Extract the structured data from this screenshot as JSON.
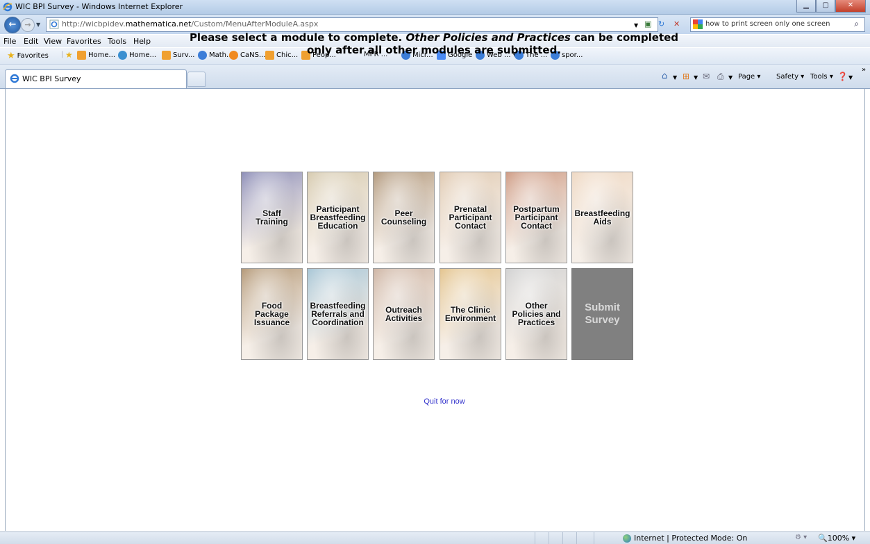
{
  "window": {
    "title": "WIC BPI Survey - Windows Internet Explorer"
  },
  "address": {
    "url_prefix": "http://wicbpidev.",
    "url_domain": "mathematica.net",
    "url_path": "/Custom/MenuAfterModuleA.aspx",
    "search_query": "how to print screen only one screen"
  },
  "menu": [
    "File",
    "Edit",
    "View",
    "Favorites",
    "Tools",
    "Help"
  ],
  "favorites": {
    "label": "Favorites",
    "items": [
      {
        "label": "Home...",
        "icon": "rss-feed-icon",
        "color": "#f0a030"
      },
      {
        "label": "Home...",
        "icon": "web-slice-icon",
        "color": "#3a8fd0"
      },
      {
        "label": "Surv...",
        "icon": "rss-feed-icon",
        "color": "#f0a030"
      },
      {
        "label": "Math...",
        "icon": "ie-page-icon",
        "color": "#3b7dd8"
      },
      {
        "label": "CaNS...",
        "icon": "orange-circle-icon",
        "color": "#f08a20"
      },
      {
        "label": "Chic...",
        "icon": "rss-feed-icon",
        "color": "#f0a030"
      },
      {
        "label": "Peop...",
        "icon": "rss-feed-icon",
        "color": "#f0a030"
      },
      {
        "label": "MPR ...",
        "icon": "",
        "color": ""
      },
      {
        "label": "Micr...",
        "icon": "ie-page-icon",
        "color": "#3b7dd8"
      },
      {
        "label": "Google",
        "icon": "google-icon",
        "color": "#4a8af4"
      },
      {
        "label": "Web ... ▾",
        "icon": "ie-page-icon",
        "color": "#3b7dd8"
      },
      {
        "label": "The ...",
        "icon": "ie-page-icon",
        "color": "#3b7dd8"
      },
      {
        "label": "spor...",
        "icon": "ie-page-icon",
        "color": "#3b7dd8"
      }
    ]
  },
  "tab": {
    "label": "WIC BPI Survey"
  },
  "commands": {
    "page": "Page ▾",
    "safety": "Safety ▾",
    "tools": "Tools ▾"
  },
  "content": {
    "heading_part1": "Please select a module to complete. ",
    "heading_italic": "Other Policies and Practices",
    "heading_part2": " can be completed",
    "heading_line2": "only after all other modules are submitted.",
    "modules": [
      {
        "label": "Staff\nTraining",
        "color": "#8e8fb8"
      },
      {
        "label": "Participant\nBreastfeeding\nEducation",
        "color": "#d7cbb0"
      },
      {
        "label": "Peer\nCounseling",
        "color": "#b39a7e"
      },
      {
        "label": "Prenatal\nParticipant\nContact",
        "color": "#e1cbb3"
      },
      {
        "label": "Postpartum\nParticipant\nContact",
        "color": "#cf9d86"
      },
      {
        "label": "Breastfeeding\nAids",
        "color": "#efd9c4"
      },
      {
        "label": "Food\nPackage\nIssuance",
        "color": "#b59a79"
      },
      {
        "label": "Breastfeeding\nReferrals and\nCoordination",
        "color": "#a8c6d6"
      },
      {
        "label": "Outreach\nActivities",
        "color": "#cfb6a5"
      },
      {
        "label": "The Clinic\nEnvironment",
        "color": "#e4c590"
      },
      {
        "label": "Other\nPolicies and\nPractices",
        "color": "#d2d2d2"
      }
    ],
    "submit_label": "Submit\nSurvey",
    "quit_label": "Quit for now"
  },
  "status": {
    "zone": "Internet | Protected Mode: On",
    "zoom": "🔍100%  ▾"
  }
}
